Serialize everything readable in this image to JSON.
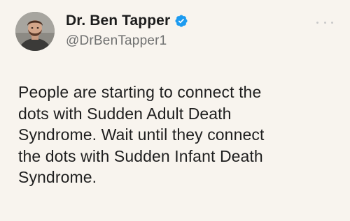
{
  "author": {
    "display_name": "Dr. Ben Tapper",
    "handle": "@DrBenTapper1",
    "verified": true,
    "avatar_icon": "profile-photo"
  },
  "tweet": {
    "lines": [
      "People are starting to connect the",
      "dots with Sudden Adult Death",
      "Syndrome. Wait until they connect",
      "the dots with Sudden Infant Death",
      "Syndrome."
    ]
  },
  "icons": {
    "verified": "verified-badge-icon",
    "more": "more-options-icon"
  },
  "colors": {
    "background": "#f8f4ee",
    "verified_blue": "#1d9bf0",
    "name": "#1c1c1c",
    "handle": "#6f7070"
  }
}
